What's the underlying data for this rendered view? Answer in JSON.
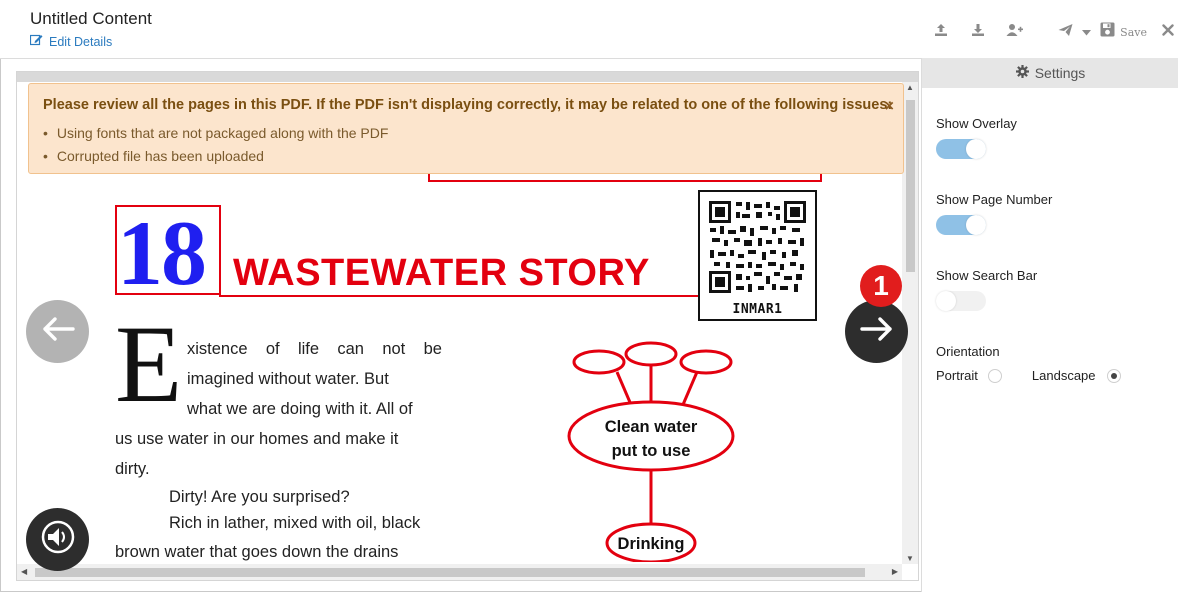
{
  "header": {
    "title": "Untitled Content",
    "edit_label": "Edit Details",
    "save_label": "Save",
    "icons": [
      "edit-icon",
      "upload-icon",
      "download-icon",
      "add-user-icon",
      "send-icon",
      "caret-down-icon",
      "save-icon",
      "close-icon"
    ]
  },
  "banner": {
    "title": "Please review all the pages in this PDF. If the PDF isn't displaying correctly, it may be related to one of the following issues:",
    "items": [
      "Using fonts that are not packaged along with the PDF",
      "Corrupted file has been uploaded"
    ],
    "close_label": "×",
    "background": "#fce5cd"
  },
  "page": {
    "chapter_number": "18",
    "chapter_title": "WASTEWATER STORY",
    "qr_label": "INMAR1",
    "drop_cap": "E",
    "intro_lines": [
      "xistence of life can not be",
      "imagined without water. But",
      "what we are doing with it. All of",
      "us use water in our homes and make it",
      "dirty."
    ],
    "line_surprised": "Dirty! Are you surprised?",
    "line_rich": "Rich in lather, mixed with oil, black",
    "line_brown": "brown water that goes down the drains",
    "diagram": {
      "center_text_1": "Clean water",
      "center_text_2": "put to use",
      "bottom_text": "Drinking"
    }
  },
  "navigation": {
    "badge": "1",
    "prev_icon": "arrow-left-icon",
    "next_icon": "arrow-right-icon",
    "audio_icon": "audio-icon"
  },
  "settings": {
    "title": "Settings",
    "show_overlay_label": "Show Overlay",
    "show_overlay": true,
    "show_page_number_label": "Show Page Number",
    "show_page_number": true,
    "show_search_bar_label": "Show Search Bar",
    "show_search_bar": false,
    "orientation_label": "Orientation",
    "orientation_options": [
      "Portrait",
      "Landscape"
    ],
    "orientation_selected": "Landscape"
  },
  "colors": {
    "accent": "#2b7bbf",
    "toggle_on": "#8fc1e6",
    "badge": "#e11d1d",
    "chapter_red": "#e3000f",
    "chapter_blue": "#1f1ff0"
  }
}
